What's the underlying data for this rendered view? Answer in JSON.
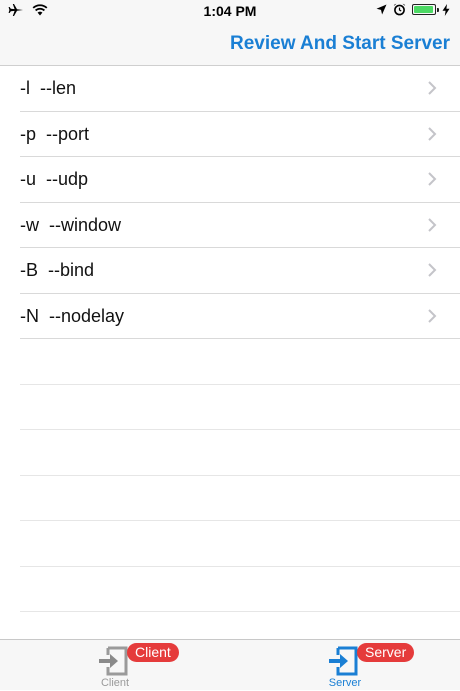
{
  "status_bar": {
    "time": "1:04 PM"
  },
  "nav": {
    "action_label": "Review And Start Server",
    "accent_color": "#1a7fd4"
  },
  "options": [
    {
      "label": "-l  --len"
    },
    {
      "label": "-p  --port"
    },
    {
      "label": "-u  --udp"
    },
    {
      "label": "-w  --window"
    },
    {
      "label": "-B  --bind"
    },
    {
      "label": "-N  --nodelay"
    }
  ],
  "tabs": [
    {
      "label": "Client",
      "badge": "Client",
      "selected": false,
      "color": "#9a9a9a"
    },
    {
      "label": "Server",
      "badge": "Server",
      "selected": true,
      "color": "#1a7fd4"
    }
  ],
  "icons": {
    "airplane": "airplane-icon",
    "wifi": "wifi-icon",
    "location": "location-arrow-icon",
    "alarm": "alarm-clock-icon",
    "battery": "battery-icon",
    "charging": "charging-bolt-icon",
    "chevron": "chevron-right-icon",
    "tab": "sign-in-icon"
  }
}
